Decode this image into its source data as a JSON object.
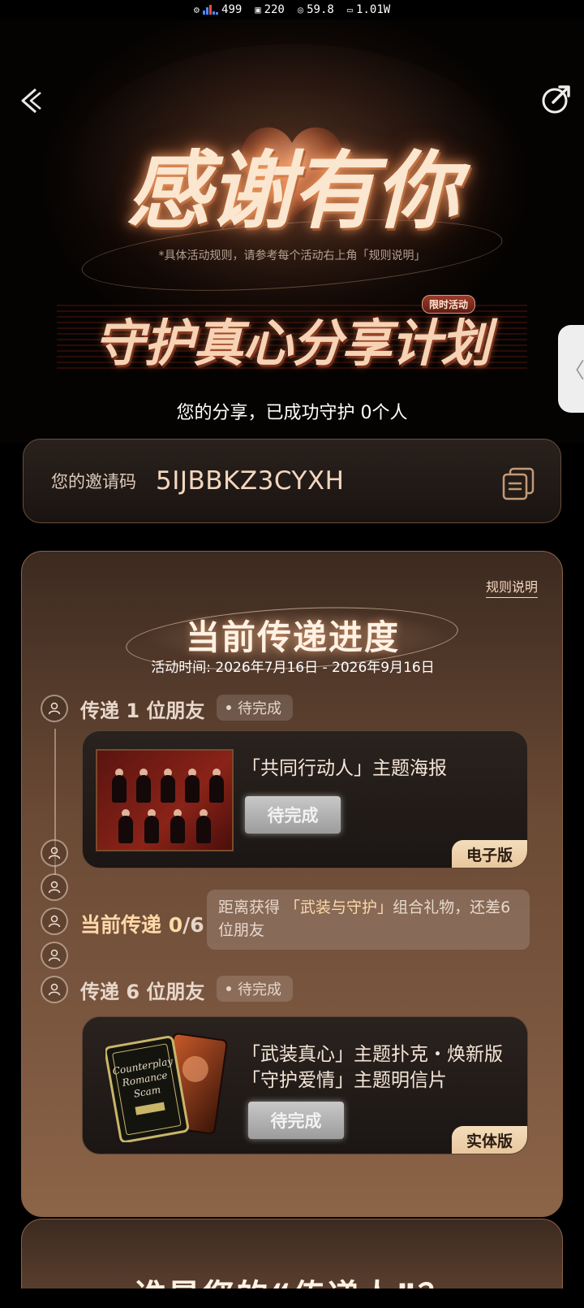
{
  "status_bar": {
    "cpu": "499",
    "gpu": "220",
    "fps": "59.8",
    "power": "1.01W"
  },
  "hero": {
    "title": "感谢有你",
    "rule_hint": "*具体活动规则，请参考每个活动右上角「规则说明」",
    "banner_title": "守护真心分享计划",
    "limited_badge": "限时活动",
    "protect_count": "您的分享，已成功守护 0个人"
  },
  "invite": {
    "label": "您的邀请码",
    "code": "5IJBBKZ3CYXH"
  },
  "progress": {
    "rules_link": "规则说明",
    "title": "当前传递进度",
    "time": "活动时间: 2026年7月16日 - 2026年9月16日",
    "stage1": {
      "label": "传递 1 位朋友",
      "status": "待完成",
      "reward_title": "「共同行动人」主题海报",
      "button": "待完成",
      "badge": "电子版"
    },
    "current": {
      "label_prefix": "当前传递 0",
      "label_suffix": "/6",
      "remain_1": "距离获得 ",
      "remain_highlight": "「武装与守护」",
      "remain_2": "组合礼物，还差",
      "remain_count": "6位朋友"
    },
    "stage2": {
      "label": "传递 6 位朋友",
      "status": "待完成",
      "reward_line1": "「武装真心」主题扑克・焕新版",
      "reward_line2": "「守护爱情」主题明信片",
      "button": "待完成",
      "badge": "实体版"
    }
  },
  "next_section": {
    "title": "谁是您的“传递人”？"
  },
  "colors": {
    "accent": "#ffd9a8",
    "badge": "#efd3ad",
    "card_bg": "#1b1614"
  }
}
